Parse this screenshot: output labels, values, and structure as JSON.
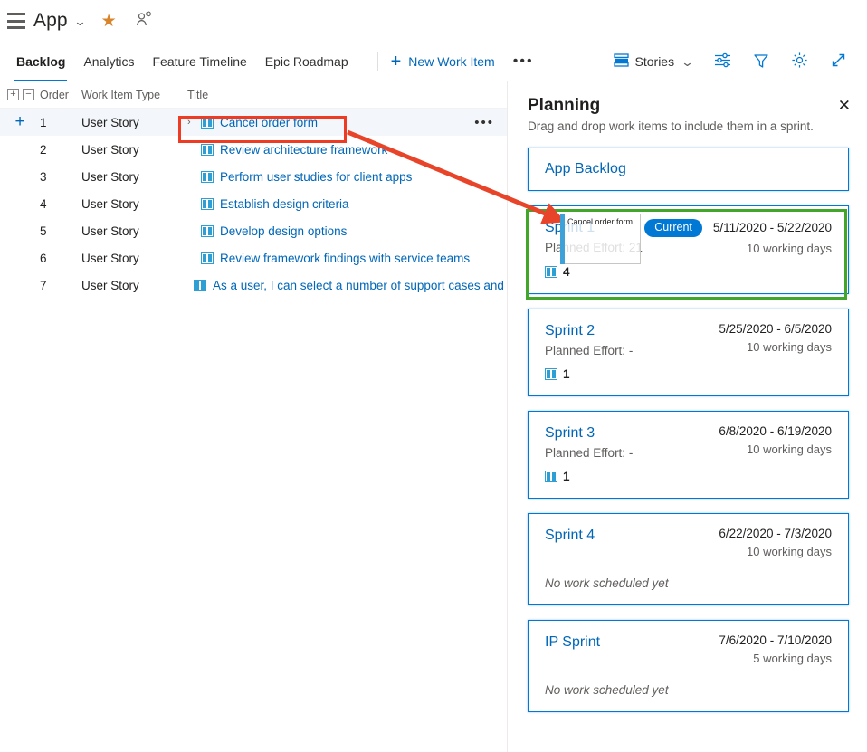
{
  "topbar": {
    "menu_icon": "hamburger-icon",
    "app_name": "App",
    "chevron": "⌄",
    "favorite_icon": "star-icon",
    "people_icon": "person-add-icon"
  },
  "nav": {
    "tabs": [
      {
        "label": "Backlog",
        "active": true
      },
      {
        "label": "Analytics",
        "active": false
      },
      {
        "label": "Feature Timeline",
        "active": false
      },
      {
        "label": "Epic Roadmap",
        "active": false
      }
    ],
    "new_work_item": "New Work Item",
    "overflow": "•••",
    "right": {
      "level_label": "Stories",
      "level_chevron": "⌄",
      "column_options_icon": "sliders-icon",
      "filter_icon": "funnel-icon",
      "settings_icon": "gear-icon",
      "fullscreen_icon": "expand-icon"
    }
  },
  "grid": {
    "expand_all": "+",
    "collapse_all": "−",
    "columns": [
      "Order",
      "Work Item Type",
      "Title"
    ],
    "rows": [
      {
        "order": "1",
        "type": "User Story",
        "title": "Cancel order form",
        "selected": true,
        "has_chevron": true,
        "add": "+",
        "dots": "•••"
      },
      {
        "order": "2",
        "type": "User Story",
        "title": "Review architecture framework",
        "selected": false,
        "has_chevron": false
      },
      {
        "order": "3",
        "type": "User Story",
        "title": "Perform user studies for client apps",
        "selected": false,
        "has_chevron": false
      },
      {
        "order": "4",
        "type": "User Story",
        "title": "Establish design criteria",
        "selected": false,
        "has_chevron": false
      },
      {
        "order": "5",
        "type": "User Story",
        "title": "Develop design options",
        "selected": false,
        "has_chevron": false
      },
      {
        "order": "6",
        "type": "User Story",
        "title": "Review framework findings with service teams",
        "selected": false,
        "has_chevron": false
      },
      {
        "order": "7",
        "type": "User Story",
        "title": "As a user, I can select a number of support cases and …",
        "selected": false,
        "has_chevron": false
      }
    ]
  },
  "panel": {
    "title": "Planning",
    "subtitle": "Drag and drop work items to include them in a sprint.",
    "close_icon": "close-icon",
    "backlog_card": {
      "label": "App Backlog"
    },
    "sprints": [
      {
        "name": "Sprint 1",
        "effort": "Planned Effort: 21",
        "badge": "Current",
        "dates": "5/11/2020 - 5/22/2020",
        "days": "10 working days",
        "count": "4",
        "no_work": ""
      },
      {
        "name": "Sprint 2",
        "effort": "Planned Effort: -",
        "badge": "",
        "dates": "5/25/2020 - 6/5/2020",
        "days": "10 working days",
        "count": "1",
        "no_work": ""
      },
      {
        "name": "Sprint 3",
        "effort": "Planned Effort: -",
        "badge": "",
        "dates": "6/8/2020 - 6/19/2020",
        "days": "10 working days",
        "count": "1",
        "no_work": ""
      },
      {
        "name": "Sprint 4",
        "effort": "",
        "badge": "",
        "dates": "6/22/2020 - 7/3/2020",
        "days": "10 working days",
        "count": "",
        "no_work": "No work scheduled yet"
      },
      {
        "name": "IP Sprint",
        "effort": "",
        "badge": "",
        "dates": "7/6/2020 - 7/10/2020",
        "days": "5 working days",
        "count": "",
        "no_work": "No work scheduled yet"
      }
    ]
  },
  "drag": {
    "ghost_label": "Cancel order form"
  },
  "annotations": {
    "highlight_color": "#ee3b24",
    "target_color": "#41a62a",
    "arrow_color": "#e8442a"
  },
  "colors": {
    "accent": "#0078d4",
    "link": "#0067b8",
    "text": "#201f1e",
    "muted": "#605e5c",
    "star": "#d9832b"
  }
}
